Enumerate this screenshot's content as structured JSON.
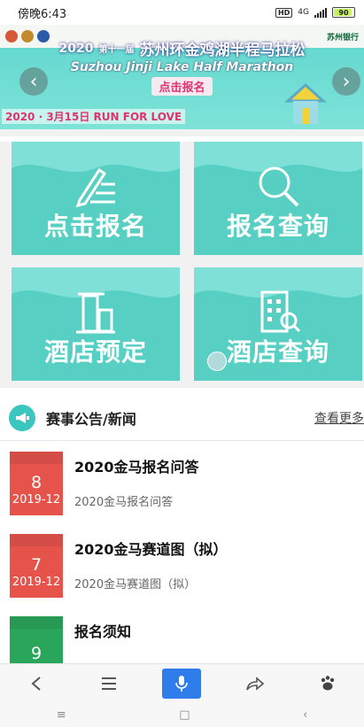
{
  "status_bar": {
    "time": "傍晚6:43",
    "hd_label": "HD",
    "network": "4G",
    "battery_level": "90",
    "battery_fraction": 0.9
  },
  "banner": {
    "year": "2020",
    "edition": "第十一届",
    "title_cn": "苏州环金鸡湖半程马拉松",
    "title_en": "Suzhou Jinji Lake Half Marathon",
    "register_button": "点击报名",
    "date": "2020 · 3月15日 RUN FOR LOVE",
    "sponsor": "苏州银行"
  },
  "tiles": [
    {
      "label": "点击报名",
      "icon": "pen-icon"
    },
    {
      "label": "报名查询",
      "icon": "magnifier-icon"
    },
    {
      "label": "酒店预定",
      "icon": "door-icon"
    },
    {
      "label": "酒店查询",
      "icon": "building-icon"
    }
  ],
  "news": {
    "section_title": "赛事公告/新闻",
    "more_link": "查看更多",
    "items": [
      {
        "day": "8",
        "year_month": "2019-12",
        "title": "2020金马报名问答",
        "summary": "2020金马报名问答",
        "color": "#e5534b"
      },
      {
        "day": "7",
        "year_month": "2019-12",
        "title": "2020金马赛道图（拟）",
        "summary": "2020金马赛道图（拟）",
        "color": "#e5534b"
      },
      {
        "day": "9",
        "year_month": "",
        "title": "报名须知",
        "summary": "",
        "color": "#2aa65b"
      }
    ]
  },
  "colors": {
    "tile": "#57d0c3",
    "accent": "#3cc6c0",
    "calendar_red": "#e5534b",
    "calendar_green": "#2aa65b",
    "mic_blue": "#2f7dea"
  },
  "toolbar": {
    "icons": [
      "back-icon",
      "menu-icon",
      "microphone-icon",
      "share-icon",
      "baidu-paw-icon"
    ]
  }
}
